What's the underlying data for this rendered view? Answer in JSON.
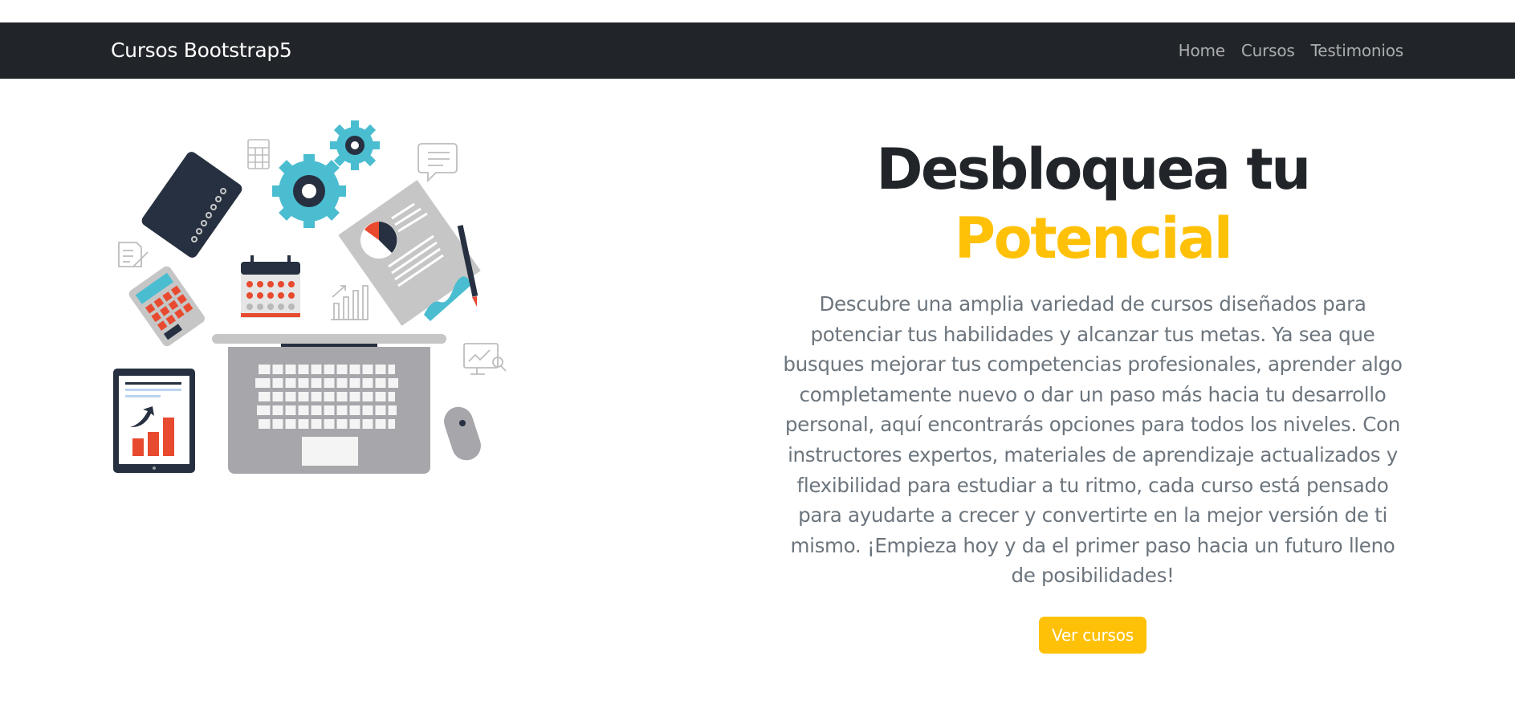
{
  "navbar": {
    "brand": "Cursos Bootstrap5",
    "links": [
      {
        "label": "Home"
      },
      {
        "label": "Cursos"
      },
      {
        "label": "Testimonios"
      }
    ]
  },
  "hero": {
    "headline_line1": "Desbloquea tu",
    "headline_line2": "Potencial",
    "description": "Descubre una amplia variedad de cursos diseñados para potenciar tus habilidades y alcanzar tus metas. Ya sea que busques mejorar tus competencias profesionales, aprender algo completamente nuevo o dar un paso más hacia tu desarrollo personal, aquí encontrarás opciones para todos los niveles. Con instructores expertos, materiales de aprendizaje actualizados y flexibilidad para estudiar a tu ritmo, cada curso está pensado para ayudarte a crecer y convertirte en la mejor versión de ti mismo. ¡Empieza hoy y da el primer paso hacia un futuro lleno de posibilidades!",
    "cta_label": "Ver cursos",
    "illustration_icons": [
      "laptop-icon",
      "gear-icon",
      "notebook-icon",
      "calendar-icon",
      "calculator-icon",
      "tablet-chart-icon",
      "report-icon",
      "pen-icon",
      "mouse-icon",
      "chat-icon",
      "bar-chart-icon",
      "document-edit-icon",
      "monitor-search-icon"
    ]
  },
  "colors": {
    "navbar_bg": "#212529",
    "accent": "#ffc107",
    "heading": "#212529",
    "body_text": "#6c757d",
    "teal": "#4bbdd0",
    "red": "#e84a2f"
  }
}
